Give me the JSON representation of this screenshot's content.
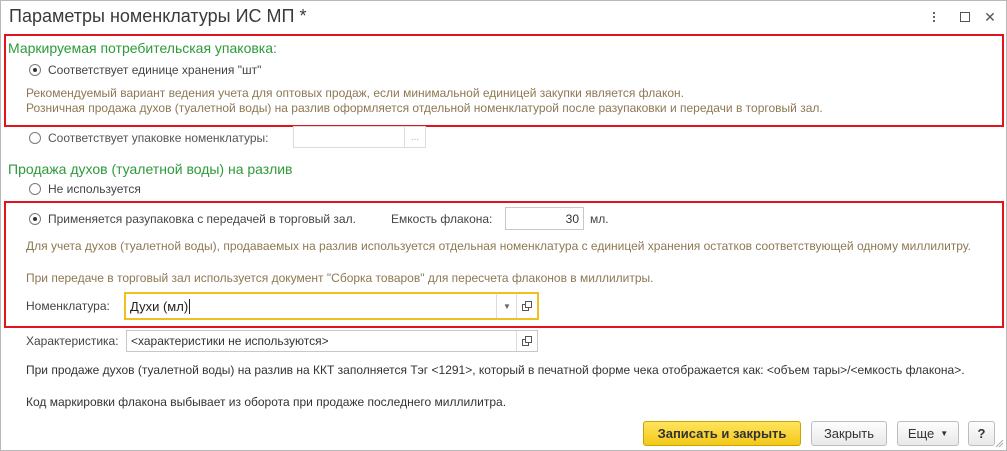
{
  "window": {
    "title": "Параметры номенклатуры ИС МП *",
    "menu_icon": "kebab-menu-icon",
    "restore_icon": "restore-icon",
    "close_icon": "close-icon"
  },
  "packaging": {
    "title": "Маркируемая потребительская упаковка:",
    "option1": {
      "label": "Соответствует единице хранения \"шт\"",
      "selected": true
    },
    "hint_line1": "Рекомендуемый вариант ведения учета для оптовых продаж, если минимальной единицей закупки является флакон.",
    "hint_line2": "Розничная продажа духов (туалетной воды) на разлив оформляется отдельной номенклатурой после разупаковки и передачи в торговый зал.",
    "option2": {
      "label": "Соответствует упаковке номенклатуры:",
      "selected": false,
      "value": ""
    },
    "option2_button": "..."
  },
  "draft": {
    "title": "Продажа духов (туалетной воды) на разлив",
    "option_not_used": {
      "label": "Не используется",
      "selected": false
    },
    "option_unpack": {
      "label": "Применяется разупаковка с передачей в торговый зал.",
      "selected": true
    },
    "capacity_label": "Емкость флакона:",
    "capacity_value": "30",
    "capacity_unit": "мл.",
    "hint1": "Для учета духов (туалетной воды), продаваемых на разлив используется отдельная номенклатура с единицей хранения остатков соответствующей одному миллилитру.",
    "hint2": "При передаче в торговый зал используется документ \"Сборка товаров\" для пересчета флаконов в миллилитры.",
    "nomenclature_label": "Номенклатура:",
    "nomenclature_value": "Духи (мл)",
    "characteristic_label": "Характеристика:",
    "characteristic_value": "<характеристики не используются>"
  },
  "footer_note": {
    "line1": "При продаже духов (туалетной воды) на разлив на ККТ заполняется Тэг <1291>, который в печатной форме чека отображается как: <объем тары>/<емкость флакона>.",
    "line2": "Код маркировки флакона выбывает из оборота при продаже последнего миллилитра."
  },
  "buttons": {
    "save_close": "Записать и закрыть",
    "close": "Закрыть",
    "more": "Еще",
    "help": "?"
  },
  "colors": {
    "section_title": "#2d9a3a",
    "hint": "#8c7853",
    "highlight_frame": "#e0141e",
    "primary_button": "#f3c819",
    "focus_border": "#f0c020"
  }
}
